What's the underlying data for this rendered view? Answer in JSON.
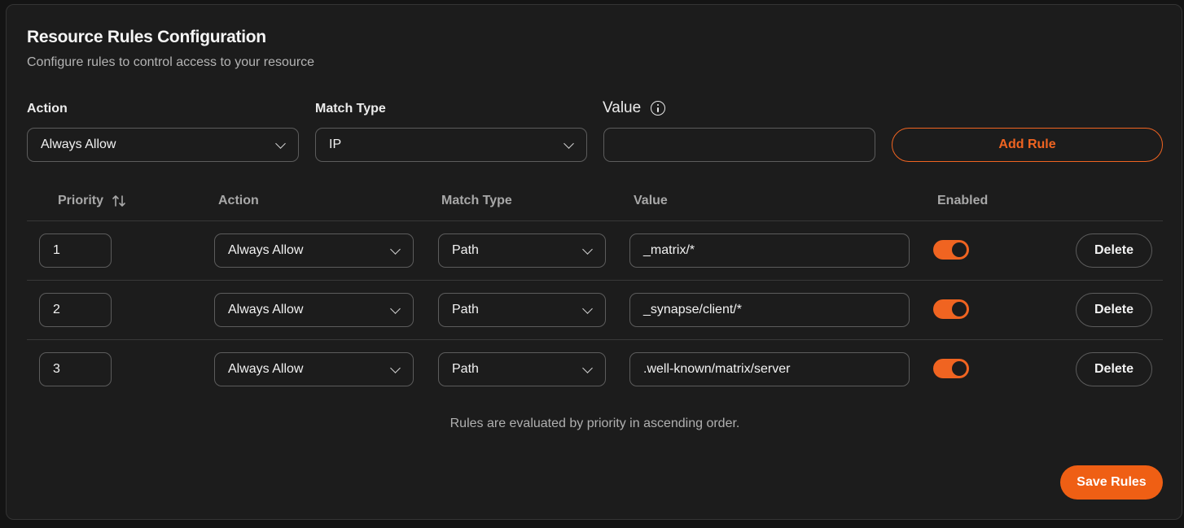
{
  "header": {
    "title": "Resource Rules Configuration",
    "subtitle": "Configure rules to control access to your resource"
  },
  "form": {
    "action_label": "Action",
    "action_value": "Always Allow",
    "match_type_label": "Match Type",
    "match_type_value": "IP",
    "value_label": "Value",
    "value_input": "",
    "value_info_icon": "info-icon",
    "add_rule_label": "Add Rule"
  },
  "table": {
    "columns": {
      "priority": "Priority",
      "action": "Action",
      "match_type": "Match Type",
      "value": "Value",
      "enabled": "Enabled"
    },
    "rows": [
      {
        "priority": "1",
        "action": "Always Allow",
        "match_type": "Path",
        "value": "_matrix/*",
        "enabled": true,
        "delete_label": "Delete"
      },
      {
        "priority": "2",
        "action": "Always Allow",
        "match_type": "Path",
        "value": "_synapse/client/*",
        "enabled": true,
        "delete_label": "Delete"
      },
      {
        "priority": "3",
        "action": "Always Allow",
        "match_type": "Path",
        "value": ".well-known/matrix/server",
        "enabled": true,
        "delete_label": "Delete"
      }
    ]
  },
  "footnote": "Rules are evaluated by priority in ascending order.",
  "save_label": "Save Rules",
  "colors": {
    "accent": "#f06421",
    "background": "#1c1c1c",
    "border": "#5c5c5c"
  }
}
